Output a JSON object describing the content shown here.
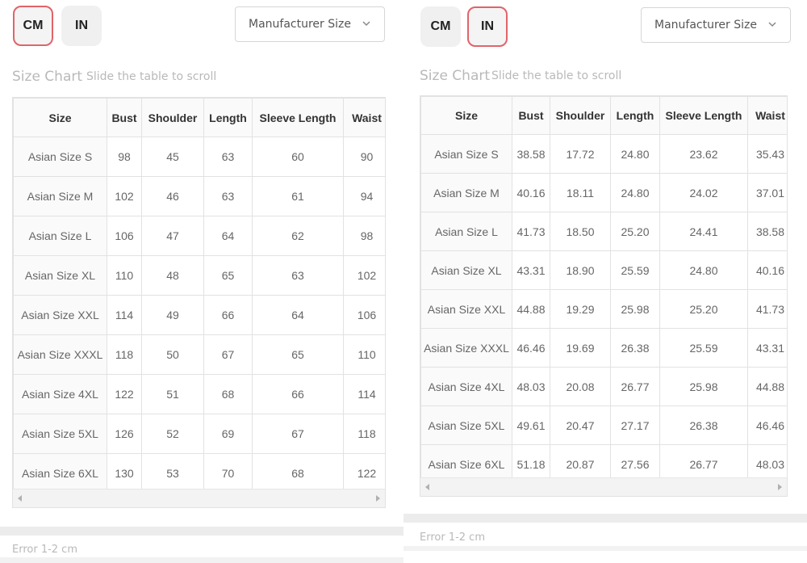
{
  "left": {
    "unit_buttons": [
      "CM",
      "IN"
    ],
    "active_unit": "CM",
    "size_select": {
      "value": "Manufacturer Size"
    },
    "chart_title": "Size Chart",
    "scroll_hint": "Slide the table to scroll",
    "columns": [
      "Size",
      "Bust",
      "Shoulder",
      "Length",
      "Sleeve Length",
      "Waist"
    ],
    "rows": [
      [
        "Asian Size S",
        "98",
        "45",
        "63",
        "60",
        "90"
      ],
      [
        "Asian Size M",
        "102",
        "46",
        "63",
        "61",
        "94"
      ],
      [
        "Asian Size L",
        "106",
        "47",
        "64",
        "62",
        "98"
      ],
      [
        "Asian Size XL",
        "110",
        "48",
        "65",
        "63",
        "102"
      ],
      [
        "Asian Size XXL",
        "114",
        "49",
        "66",
        "64",
        "106"
      ],
      [
        "Asian Size XXXL",
        "118",
        "50",
        "67",
        "65",
        "110"
      ],
      [
        "Asian Size 4XL",
        "122",
        "51",
        "68",
        "66",
        "114"
      ],
      [
        "Asian Size 5XL",
        "126",
        "52",
        "69",
        "67",
        "118"
      ],
      [
        "Asian Size 6XL",
        "130",
        "53",
        "70",
        "68",
        "122"
      ]
    ],
    "error_note": "Error 1-2 cm"
  },
  "right": {
    "unit_buttons": [
      "CM",
      "IN"
    ],
    "active_unit": "IN",
    "size_select": {
      "value": "Manufacturer Size"
    },
    "chart_title": "Size Chart",
    "scroll_hint": "Slide the table to scroll",
    "columns": [
      "Size",
      "Bust",
      "Shoulder",
      "Length",
      "Sleeve Length",
      "Waist"
    ],
    "rows": [
      [
        "Asian Size S",
        "38.58",
        "17.72",
        "24.80",
        "23.62",
        "35.43"
      ],
      [
        "Asian Size M",
        "40.16",
        "18.11",
        "24.80",
        "24.02",
        "37.01"
      ],
      [
        "Asian Size L",
        "41.73",
        "18.50",
        "25.20",
        "24.41",
        "38.58"
      ],
      [
        "Asian Size XL",
        "43.31",
        "18.90",
        "25.59",
        "24.80",
        "40.16"
      ],
      [
        "Asian Size XXL",
        "44.88",
        "19.29",
        "25.98",
        "25.20",
        "41.73"
      ],
      [
        "Asian Size XXXL",
        "46.46",
        "19.69",
        "26.38",
        "25.59",
        "43.31"
      ],
      [
        "Asian Size 4XL",
        "48.03",
        "20.08",
        "26.77",
        "25.98",
        "44.88"
      ],
      [
        "Asian Size 5XL",
        "49.61",
        "20.47",
        "27.17",
        "26.38",
        "46.46"
      ],
      [
        "Asian Size 6XL",
        "51.18",
        "20.87",
        "27.56",
        "26.77",
        "48.03"
      ]
    ],
    "error_note": "Error 1-2 cm"
  }
}
